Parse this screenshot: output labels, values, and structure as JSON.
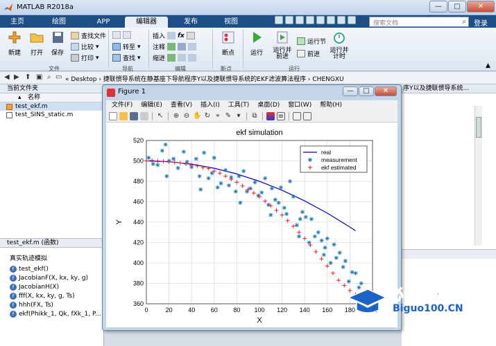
{
  "window": {
    "title": "MATLAB R2018a"
  },
  "tabs": [
    "主页",
    "绘图",
    "APP",
    "编辑器",
    "发布",
    "视图"
  ],
  "search": {
    "placeholder": "搜索文档"
  },
  "login_label": "登录",
  "ribbon": {
    "file": {
      "new": "新建",
      "open": "打开",
      "save": "保存",
      "find_files": "查找文件",
      "compare": "比较",
      "print": "打印",
      "group": "文件"
    },
    "navigate": {
      "goto": "转至",
      "find": "查找",
      "group": "导航"
    },
    "edit": {
      "insert": "插入",
      "comment": "注释",
      "indent": "缩进",
      "group": "编辑"
    },
    "breakpoints": {
      "label": "断点",
      "group": "断点"
    },
    "run": {
      "run": "运行",
      "run_advance": "运行并\n前进",
      "run_section": "运行节",
      "advance": "前进",
      "run_time": "运行并\n计时",
      "group": "运行"
    }
  },
  "address": {
    "path": "« Desktop › 捷联惯导系统在静基座下导航程序Y以及捷联惯导系统的EKF滤波算法程序 › CHENGXU"
  },
  "left_panel": {
    "header": "当前文件夹",
    "col_name": "名称",
    "files": [
      "test_ekf.m",
      "test_SINS_static.m"
    ],
    "details": "test_ekf.m  (函数)",
    "details_title": "真实轨迹模拟",
    "functions": [
      "test_ekf()",
      "JacobianF(X, kx, ky, g)",
      "JacobianH(X)",
      "fff(X, kx, ky, g, Ts)",
      "hhh(FX, Ts)",
      "ekf(Phikk_1, Qk, fXk_1, P..."
    ]
  },
  "right_panel": {
    "header": "序Y以及捷联惯导系统..."
  },
  "figure": {
    "title": "Figure 1",
    "menus": [
      "文件(F)",
      "编辑(E)",
      "查看(V)",
      "插入(I)",
      "工具(T)",
      "桌面(D)",
      "窗口(W)",
      "帮助(H)"
    ]
  },
  "watermark": {
    "line1": "必过源码",
    "line2": "Biguo100.CN"
  },
  "chart_data": {
    "type": "scatter",
    "title": "ekf simulation",
    "xlabel": "X",
    "ylabel": "Y",
    "xlim": [
      0,
      200
    ],
    "ylim": [
      360,
      520
    ],
    "xticks": [
      0,
      20,
      40,
      60,
      80,
      100,
      120,
      140,
      160,
      180,
      200
    ],
    "yticks": [
      360,
      380,
      400,
      420,
      440,
      460,
      480,
      500,
      520
    ],
    "grid": true,
    "legend_position": "top-right",
    "colors": {
      "real": "#0000cc",
      "measurement": "#1f77b4",
      "ekf": "#e8202a"
    },
    "series": [
      {
        "name": "real",
        "mode": "line",
        "x": [
          0,
          20,
          40,
          60,
          80,
          100,
          120,
          140,
          160,
          180,
          185
        ],
        "y": [
          500,
          499.2,
          496.8,
          492.8,
          487.2,
          480,
          471.2,
          460.8,
          448.8,
          435.2,
          431.5
        ]
      },
      {
        "name": "measurement",
        "mode": "markers",
        "x": [
          2,
          6,
          10,
          14,
          17,
          20,
          24,
          28,
          33,
          36,
          40,
          44,
          47,
          51,
          55,
          58,
          60,
          63,
          66,
          70,
          73,
          75,
          79,
          82,
          86,
          89,
          92,
          96,
          99,
          102,
          105,
          108,
          111,
          114,
          117,
          119,
          122,
          124,
          127,
          130,
          133,
          136,
          138,
          141,
          144,
          146,
          149,
          152,
          155,
          158,
          160,
          163,
          166,
          168,
          171,
          174,
          176,
          179,
          182,
          185,
          188,
          190,
          18,
          48,
          83,
          110,
          135,
          157
        ],
        "y": [
          503,
          497,
          496,
          510,
          516,
          500,
          502,
          493,
          509,
          499,
          494,
          502,
          485,
          508,
          483,
          488,
          503,
          474,
          478,
          491,
          476,
          484,
          470,
          485,
          490,
          470,
          473,
          479,
          466,
          469,
          483,
          457,
          473,
          462,
          459,
          474,
          454,
          448,
          480,
          465,
          437,
          443,
          450,
          445,
          420,
          443,
          426,
          430,
          422,
          415,
          424,
          400,
          418,
          405,
          410,
          396,
          402,
          382,
          391,
          390,
          376,
          380,
          485,
          472,
          459,
          447,
          426,
          408
        ]
      },
      {
        "name": "ekf estimated",
        "mode": "markers",
        "x": [
          0,
          5,
          10,
          15,
          20,
          25,
          30,
          35,
          40,
          45,
          50,
          55,
          60,
          65,
          70,
          75,
          80,
          85,
          90,
          95,
          100,
          105,
          110,
          115,
          120,
          125,
          130,
          135,
          140,
          145,
          150,
          155,
          160,
          165,
          170,
          175,
          180,
          185
        ],
        "y": [
          500,
          500.5,
          500,
          499.5,
          499,
          498.5,
          498,
          497,
          496,
          495,
          493.5,
          492.5,
          490,
          488,
          485,
          482,
          479,
          475.5,
          472,
          468.5,
          465,
          460.5,
          456,
          451.5,
          447,
          441.5,
          436,
          430,
          424,
          417.5,
          411,
          404,
          397,
          390,
          383,
          378,
          373,
          369
        ]
      }
    ]
  }
}
